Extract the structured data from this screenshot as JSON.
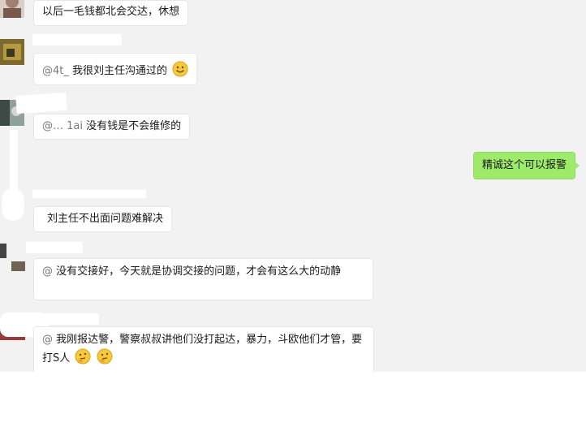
{
  "messages": [
    {
      "text": "以后一毛钱都北会交达，休想"
    },
    {
      "prefix": "@4t_  ",
      "text": "我很刘主任沟通过的"
    },
    {
      "prefix": "@… 1ai",
      "text": "没有钱是不会维修的"
    },
    {
      "text": "精诚这个可以报警"
    },
    {
      "text": "刘主任不出面问题难解决"
    },
    {
      "prefix": "@",
      "text": "没有交接好，今天就是协调交接的问题，才会有这么大的动静"
    },
    {
      "prefix": "@",
      "text": "我刚报达警，警察叔叔讲他们没打起达，暴力，斗欧他们才管，要打S人"
    }
  ],
  "colors": {
    "self_bubble": "#9eea6a",
    "chat_bg": "#f2f2f2"
  },
  "icons": [
    "smile-emoji-icon",
    "thinking-emoji-icon"
  ]
}
